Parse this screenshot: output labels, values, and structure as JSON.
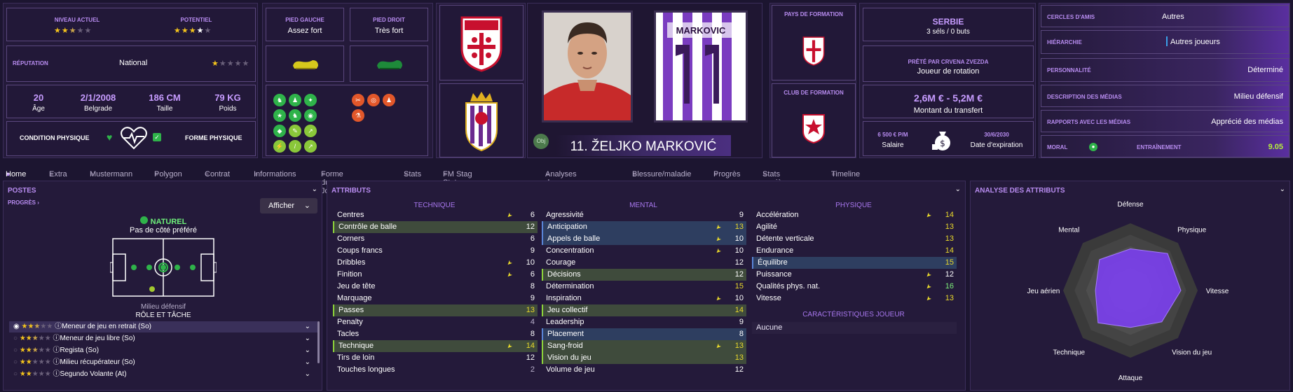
{
  "colors": {
    "accent": "#b88cf0",
    "star": "#f3c31c",
    "green": "#2fb34a",
    "yellow": "#e9d92b",
    "purple": "#7b3ff0"
  },
  "top": {
    "current_level_label": "NIVEAU ACTUEL",
    "current_level_stars": 2.5,
    "potential_label": "POTENTIEL",
    "potential_stars": 3.5,
    "reputation_label": "RÉPUTATION",
    "reputation_value": "National",
    "reputation_stars": 1,
    "age_value": "20",
    "age_label": "Âge",
    "birth_value": "2/1/2008",
    "birth_label": "Belgrade",
    "height_value": "186 CM",
    "height_label": "Taille",
    "weight_value": "79 KG",
    "weight_label": "Poids",
    "condition_label": "CONDITION PHYSIQUE",
    "form_label": "FORME PHYSIQUE",
    "left_foot_label": "PIED GAUCHE",
    "left_foot_value": "Assez fort",
    "right_foot_label": "PIED DROIT",
    "right_foot_value": "Très fort",
    "jersey_name": "MARKOVIC",
    "jersey_number": "11",
    "player_name": "11. ŽELJKO MARKOVIĆ",
    "obj_label": "Obj",
    "training_country_label": "PAYS DE FORMATION",
    "training_club_label": "CLUB DE FORMATION",
    "nation_name": "SERBIE",
    "caps": "3 séls / 0 buts",
    "loan_label": "PRÊTÉ PAR CRVENA ZVEZDA",
    "loan_role": "Joueur de rotation",
    "value_range": "2,6M € - 5,2M €",
    "value_label": "Montant du transfert",
    "salary_value": "6 500 € P/M",
    "salary_label": "Salaire",
    "expiry_value": "30/6/2030",
    "expiry_label": "Date d'expiration",
    "friends_label": "CERCLES D'AMIS",
    "friends_value": "Autres",
    "hierarchy_label": "HIÉRARCHIE",
    "hierarchy_value": "Autres joueurs",
    "personality_label": "PERSONNALITÉ",
    "personality_value": "Déterminé",
    "media_desc_label": "DESCRIPTION DES MÉDIAS",
    "media_desc_value": "Milieu défensif",
    "media_rel_label": "RAPPORTS AVEC LES MÉDIAS",
    "media_rel_value": "Apprécié des médias",
    "morale_label": "MORAL",
    "training_label": "ENTRAÎNEMENT",
    "training_value": "9.05"
  },
  "nav": [
    "Home",
    "Extra",
    "Mustermann",
    "Polygon",
    "Contrat",
    "Informations",
    "Forme du Joueur",
    "Stats",
    "FM Stag Stats Powered",
    "Analyses de joueur",
    "Blessure/maladie",
    "Progrès",
    "Stats carrière",
    "Timeline"
  ],
  "positions": {
    "title": "POSTES",
    "progress": "PROGRÈS",
    "show_button": "Afficher",
    "natural": "NATUREL",
    "foot_pref": "Pas de côté préféré",
    "role_position": "Milieu défensif",
    "role_duty": "RÔLE ET TÂCHE",
    "roles": [
      {
        "name": "Meneur de jeu en retrait (So)",
        "stars": 2.5
      },
      {
        "name": "Meneur de jeu libre (So)",
        "stars": 2.5
      },
      {
        "name": "Regista (So)",
        "stars": 2.5
      },
      {
        "name": "Milieu récupérateur (So)",
        "stars": 2
      },
      {
        "name": "Segundo Volante (At)",
        "stars": 2
      }
    ]
  },
  "attributes": {
    "title": "ATTRIBUTS",
    "technical_title": "TECHNIQUE",
    "mental_title": "MENTAL",
    "physical_title": "PHYSIQUE",
    "traits_title": "CARACTÉRISTIQUES JOUEUR",
    "traits_value": "Aucune",
    "technical": [
      {
        "name": "Centres",
        "value": "6",
        "arrow": true,
        "hl": ""
      },
      {
        "name": "Contrôle de balle",
        "value": "12",
        "arrow": false,
        "hl": "g"
      },
      {
        "name": "Corners",
        "value": "6",
        "arrow": false,
        "hl": ""
      },
      {
        "name": "Coups francs",
        "value": "9",
        "arrow": false,
        "hl": ""
      },
      {
        "name": "Dribbles",
        "value": "10",
        "arrow": true,
        "hl": ""
      },
      {
        "name": "Finition",
        "value": "6",
        "arrow": true,
        "hl": ""
      },
      {
        "name": "Jeu de tête",
        "value": "8",
        "arrow": false,
        "hl": ""
      },
      {
        "name": "Marquage",
        "value": "9",
        "arrow": false,
        "hl": ""
      },
      {
        "name": "Passes",
        "value": "13",
        "arrow": false,
        "hl": "g"
      },
      {
        "name": "Penalty",
        "value": "4",
        "arrow": false,
        "hl": ""
      },
      {
        "name": "Tacles",
        "value": "8",
        "arrow": false,
        "hl": ""
      },
      {
        "name": "Technique",
        "value": "14",
        "arrow": true,
        "hl": "g"
      },
      {
        "name": "Tirs de loin",
        "value": "12",
        "arrow": false,
        "hl": ""
      },
      {
        "name": "Touches longues",
        "value": "2",
        "arrow": false,
        "hl": ""
      }
    ],
    "mental": [
      {
        "name": "Agressivité",
        "value": "9",
        "arrow": false,
        "hl": ""
      },
      {
        "name": "Anticipation",
        "value": "13",
        "arrow": true,
        "hl": "b"
      },
      {
        "name": "Appels de balle",
        "value": "10",
        "arrow": true,
        "hl": "b"
      },
      {
        "name": "Concentration",
        "value": "10",
        "arrow": true,
        "hl": ""
      },
      {
        "name": "Courage",
        "value": "12",
        "arrow": false,
        "hl": ""
      },
      {
        "name": "Décisions",
        "value": "12",
        "arrow": false,
        "hl": "g"
      },
      {
        "name": "Détermination",
        "value": "15",
        "arrow": false,
        "hl": ""
      },
      {
        "name": "Inspiration",
        "value": "10",
        "arrow": true,
        "hl": ""
      },
      {
        "name": "Jeu collectif",
        "value": "14",
        "arrow": false,
        "hl": "g"
      },
      {
        "name": "Leadership",
        "value": "9",
        "arrow": false,
        "hl": ""
      },
      {
        "name": "Placement",
        "value": "8",
        "arrow": false,
        "hl": "b"
      },
      {
        "name": "Sang-froid",
        "value": "13",
        "arrow": true,
        "hl": "g"
      },
      {
        "name": "Vision du jeu",
        "value": "13",
        "arrow": false,
        "hl": "g"
      },
      {
        "name": "Volume de jeu",
        "value": "12",
        "arrow": false,
        "hl": ""
      }
    ],
    "physical": [
      {
        "name": "Accélération",
        "value": "14",
        "arrow": true,
        "hl": ""
      },
      {
        "name": "Agilité",
        "value": "13",
        "arrow": false,
        "hl": ""
      },
      {
        "name": "Détente verticale",
        "value": "13",
        "arrow": false,
        "hl": ""
      },
      {
        "name": "Endurance",
        "value": "14",
        "arrow": false,
        "hl": ""
      },
      {
        "name": "Équilibre",
        "value": "15",
        "arrow": false,
        "hl": "b"
      },
      {
        "name": "Puissance",
        "value": "12",
        "arrow": true,
        "hl": ""
      },
      {
        "name": "Qualités phys. nat.",
        "value": "16",
        "arrow": true,
        "hl": ""
      },
      {
        "name": "Vitesse",
        "value": "13",
        "arrow": true,
        "hl": ""
      }
    ]
  },
  "analysis": {
    "title": "ANALYSE DES ATTRIBUTS",
    "axes": [
      "Défense",
      "Physique",
      "Vitesse",
      "Vision du jeu",
      "Attaque",
      "Technique",
      "Jeu aérien",
      "Mental"
    ],
    "values": [
      0.62,
      0.78,
      0.75,
      0.66,
      0.55,
      0.68,
      0.52,
      0.65
    ]
  }
}
